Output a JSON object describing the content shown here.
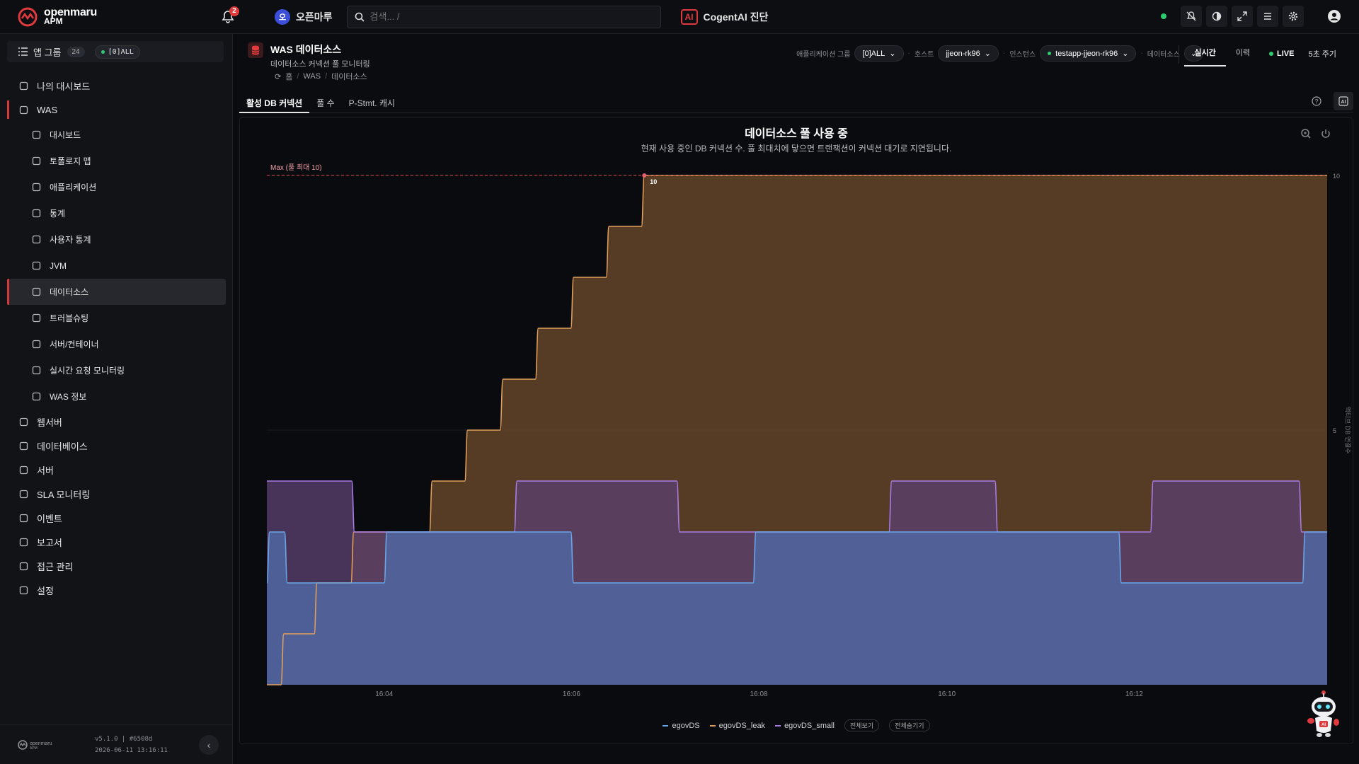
{
  "brand": {
    "name": "openmaru",
    "product": "APM"
  },
  "notifications": {
    "count": "2"
  },
  "org": {
    "initial": "오",
    "name": "오픈마루"
  },
  "search": {
    "placeholder": "검색... /"
  },
  "ai": {
    "badge": "AI",
    "label": "CogentAI 진단"
  },
  "sidebar": {
    "app_group_label": "앱 그룹",
    "app_group_count": "24",
    "app_group_selected": "[0]ALL",
    "items": [
      {
        "label": "나의 대시보드",
        "icon": "dashboard-grid-icon"
      },
      {
        "label": "WAS",
        "icon": "server-stack-icon"
      },
      {
        "label": "대시보드",
        "icon": "gauge-icon",
        "sub": true
      },
      {
        "label": "토폴로지 맵",
        "icon": "topology-icon",
        "sub": true
      },
      {
        "label": "애플리케이션",
        "icon": "area-chart-icon",
        "sub": true
      },
      {
        "label": "통계",
        "icon": "bar-chart-icon",
        "sub": true
      },
      {
        "label": "사용자 통계",
        "icon": "users-icon",
        "sub": true
      },
      {
        "label": "JVM",
        "icon": "coffee-icon",
        "sub": true
      },
      {
        "label": "데이터소스",
        "icon": "database-icon",
        "sub": true
      },
      {
        "label": "트러블슈팅",
        "icon": "search-icon",
        "sub": true
      },
      {
        "label": "서버/컨테이너",
        "icon": "chip-icon",
        "sub": true
      },
      {
        "label": "실시간 요청 모니터링",
        "icon": "flask-icon",
        "sub": true
      },
      {
        "label": "WAS 정보",
        "icon": "info-icon",
        "sub": true
      },
      {
        "label": "웹서버",
        "icon": "globe-icon"
      },
      {
        "label": "데이터베이스",
        "icon": "database-icon"
      },
      {
        "label": "서버",
        "icon": "monitor-icon"
      },
      {
        "label": "SLA 모니터링",
        "icon": "heart-pulse-icon"
      },
      {
        "label": "이벤트",
        "icon": "bell-icon"
      },
      {
        "label": "보고서",
        "icon": "report-icon"
      },
      {
        "label": "접근 관리",
        "icon": "shield-icon"
      },
      {
        "label": "설정",
        "icon": "gears-icon"
      }
    ],
    "version": "v5.1.0 | #6508d",
    "build_date": "2026-06-11 13:16:11"
  },
  "page": {
    "title": "WAS 데이터소스",
    "subtitle": "데이터소스 커넥션 풀 모니터링",
    "breadcrumb": [
      "홈",
      "WAS",
      "데이터소스"
    ]
  },
  "filters": {
    "app_group_label": "애플리케이션 그룹",
    "app_group_value": "[0]ALL",
    "host_label": "호스트",
    "host_value": "jjeon-rk96",
    "instance_label": "인스턴스",
    "instance_value": "testapp-jjeon-rk96",
    "datasource_label": "데이터소스"
  },
  "modes": {
    "realtime": "실시간",
    "history": "이력"
  },
  "live": {
    "label": "LIVE",
    "interval": "5초 주기"
  },
  "tabs": [
    "활성 DB 커넥션",
    "풀 수",
    "P-Stmt. 캐시"
  ],
  "chart_data": {
    "type": "area",
    "title": "데이터소스 풀 사용 중",
    "subtitle": "현재 사용 중인 DB 커넥션 수. 풀 최대치에 닿으면 트랜잭션이 커넥션 대기로 지연됩니다.",
    "ylabel": "액티브 DB 연결수",
    "ylim": [
      0,
      10
    ],
    "yticks": [
      "5",
      "10"
    ],
    "xticks": [
      "16:04",
      "16:06",
      "16:08",
      "16:10",
      "16:12"
    ],
    "max_line": {
      "label": "Max (풀 최대 10)",
      "value": 10
    },
    "peak_label": "10",
    "series": [
      {
        "name": "egovDS",
        "color": "#6aa6e8",
        "fill": "#4f6aa8",
        "points": [
          [
            16.0,
            2
          ],
          [
            16.04,
            3
          ],
          [
            16.25,
            3
          ],
          [
            16.29,
            2
          ],
          [
            17.66,
            2
          ],
          [
            17.7,
            3
          ],
          [
            20.3,
            3
          ],
          [
            20.34,
            2
          ],
          [
            22.88,
            2
          ],
          [
            22.92,
            3
          ],
          [
            28.05,
            3
          ],
          [
            28.09,
            2
          ],
          [
            30.65,
            2
          ],
          [
            30.69,
            3
          ],
          [
            31.0,
            3
          ]
        ]
      },
      {
        "name": "egovDS_leak",
        "color": "#e0a05a",
        "fill": "#6b4a2a",
        "points": [
          [
            16.0,
            0
          ],
          [
            16.2,
            0
          ],
          [
            16.24,
            1
          ],
          [
            16.67,
            1
          ],
          [
            16.71,
            2
          ],
          [
            17.19,
            2
          ],
          [
            17.23,
            3
          ],
          [
            17.67,
            3
          ],
          [
            17.71,
            3
          ],
          [
            18.3,
            3
          ],
          [
            18.34,
            4
          ],
          [
            18.8,
            4
          ],
          [
            18.84,
            5
          ],
          [
            19.3,
            5
          ],
          [
            19.34,
            6
          ],
          [
            19.8,
            6
          ],
          [
            19.84,
            7
          ],
          [
            20.3,
            7
          ],
          [
            20.34,
            8
          ],
          [
            20.8,
            8
          ],
          [
            20.84,
            9
          ],
          [
            21.3,
            9
          ],
          [
            21.34,
            10
          ],
          [
            31.0,
            10
          ]
        ]
      },
      {
        "name": "egovDS_small",
        "color": "#a97ce8",
        "fill": "#5a3f6e",
        "points": [
          [
            16.0,
            4
          ],
          [
            17.2,
            4
          ],
          [
            17.24,
            3
          ],
          [
            19.5,
            3
          ],
          [
            19.54,
            4
          ],
          [
            21.8,
            4
          ],
          [
            21.84,
            3
          ],
          [
            24.8,
            3
          ],
          [
            24.84,
            4
          ],
          [
            26.3,
            4
          ],
          [
            26.34,
            3
          ],
          [
            28.5,
            3
          ],
          [
            28.54,
            4
          ],
          [
            30.6,
            4
          ],
          [
            30.64,
            3
          ],
          [
            31.0,
            3
          ]
        ]
      }
    ]
  },
  "legend_buttons": {
    "show_all": "전체보기",
    "hide_all": "전체숨기기"
  }
}
